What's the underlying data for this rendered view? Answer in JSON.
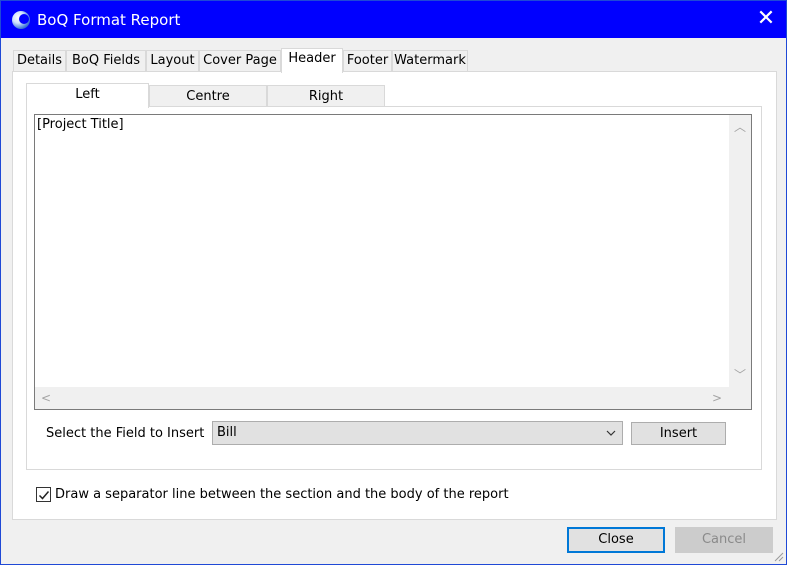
{
  "window": {
    "title": "BoQ Format Report",
    "close_glyph": "✕"
  },
  "tabs": [
    {
      "label": "Details"
    },
    {
      "label": "BoQ Fields"
    },
    {
      "label": "Layout"
    },
    {
      "label": "Cover Page"
    },
    {
      "label": "Header"
    },
    {
      "label": "Footer"
    },
    {
      "label": "Watermark"
    }
  ],
  "active_tab": "Header",
  "subtabs": [
    {
      "label": "Left"
    },
    {
      "label": "Centre"
    },
    {
      "label": "Right"
    }
  ],
  "active_subtab": "Left",
  "editor": {
    "text": "[Project Title]"
  },
  "field_insert": {
    "label": "Select the Field to Insert",
    "selected": "Bill",
    "insert_label": "Insert"
  },
  "separator_option": {
    "label": "Draw a separator line between the section and the body of the report",
    "checked": true
  },
  "footer_buttons": {
    "close_label": "Close",
    "cancel_label": "Cancel"
  },
  "icons": {
    "app": "app-logo-icon",
    "close": "close-icon",
    "dropdown": "chevron-down-icon",
    "check": "checkmark-icon",
    "resize": "resize-grip-icon"
  },
  "colors": {
    "titlebar": "#0000ff",
    "focus_border": "#0078d7"
  }
}
